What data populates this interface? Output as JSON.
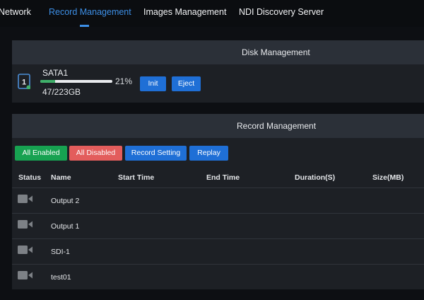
{
  "nav": {
    "tabs": [
      {
        "label": "Network",
        "active": false
      },
      {
        "label": "Record Management",
        "active": true
      },
      {
        "label": "Images Management",
        "active": false
      },
      {
        "label": "NDI Discovery Server",
        "active": false
      }
    ]
  },
  "disk_panel": {
    "title": "Disk Management",
    "disk": {
      "icon": "disk-drive-icon",
      "number": "1",
      "name": "SATA1",
      "usage_fraction": 0.21,
      "usage_text": "21%",
      "size_text": "47/223GB",
      "status_color": "#3fb06a"
    },
    "buttons": {
      "init": "Init",
      "eject": "Eject"
    }
  },
  "record_panel": {
    "title": "Record Management",
    "buttons": {
      "all_enabled": "All Enabled",
      "all_disabled": "All Disabled",
      "record_setting": "Record Setting",
      "replay": "Replay"
    },
    "columns": [
      "Status",
      "Name",
      "Start Time",
      "End Time",
      "Duration(S)",
      "Size(MB)"
    ],
    "rows": [
      {
        "status_icon": "camera-icon",
        "name": "Output 2"
      },
      {
        "status_icon": "camera-icon",
        "name": "Output 1"
      },
      {
        "status_icon": "camera-icon",
        "name": "SDI-1"
      },
      {
        "status_icon": "camera-icon",
        "name": "test01"
      }
    ]
  },
  "colors": {
    "accent": "#3d8fe6",
    "button_blue": "#1f6fd6",
    "button_green": "#17a251",
    "button_red": "#e35d5c"
  }
}
